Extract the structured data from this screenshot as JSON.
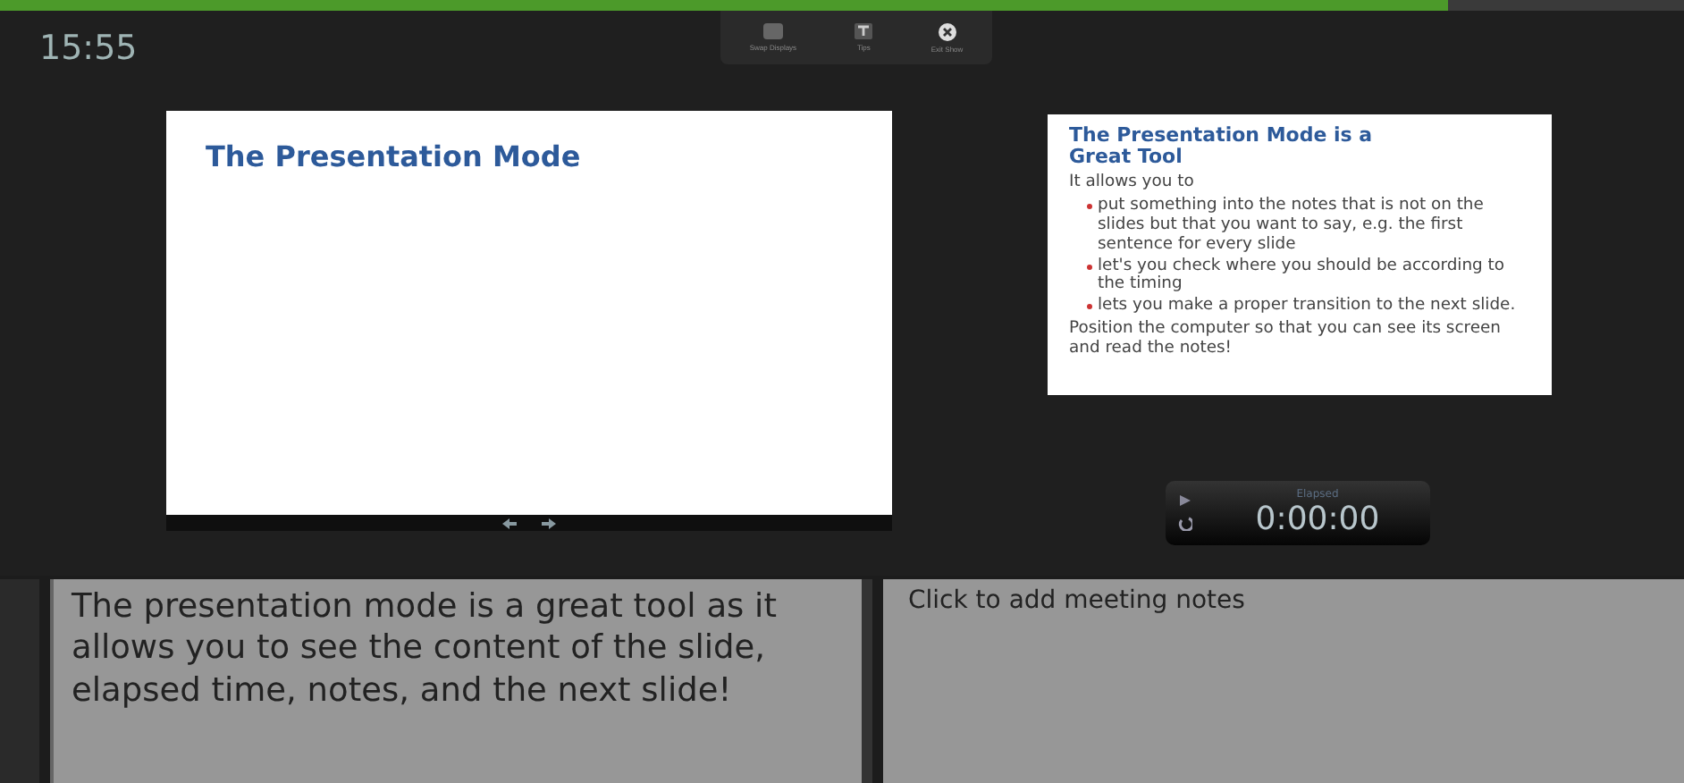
{
  "progress": {
    "level": 0.86
  },
  "clock": "15:55",
  "toolbar": [
    {
      "kind": "swap",
      "label": "Swap Displays"
    },
    {
      "kind": "tips",
      "label": "Tips"
    },
    {
      "kind": "exit",
      "label": "Exit Show"
    }
  ],
  "current_slide": {
    "title": "The Presentation Mode"
  },
  "next_slide": {
    "title": "The Presentation Mode is a Great Tool",
    "intro": "It allows you to",
    "bullets": [
      "put something into the notes that is not on the slides but that you want to say, e.g. the first sentence for every slide",
      "let's you check where you should be according to the timing",
      "lets you make a proper transition to the next slide."
    ],
    "closing": "Position the computer so that you can see its screen and read the notes!"
  },
  "timer": {
    "label": "Elapsed",
    "time": "0:00:00"
  },
  "speaker_notes": "The presentation mode is a great tool as it allows you to see the content of the slide, elapsed time, notes, and the next slide!",
  "meeting_notes": {
    "placeholder": "Click to add meeting notes"
  }
}
